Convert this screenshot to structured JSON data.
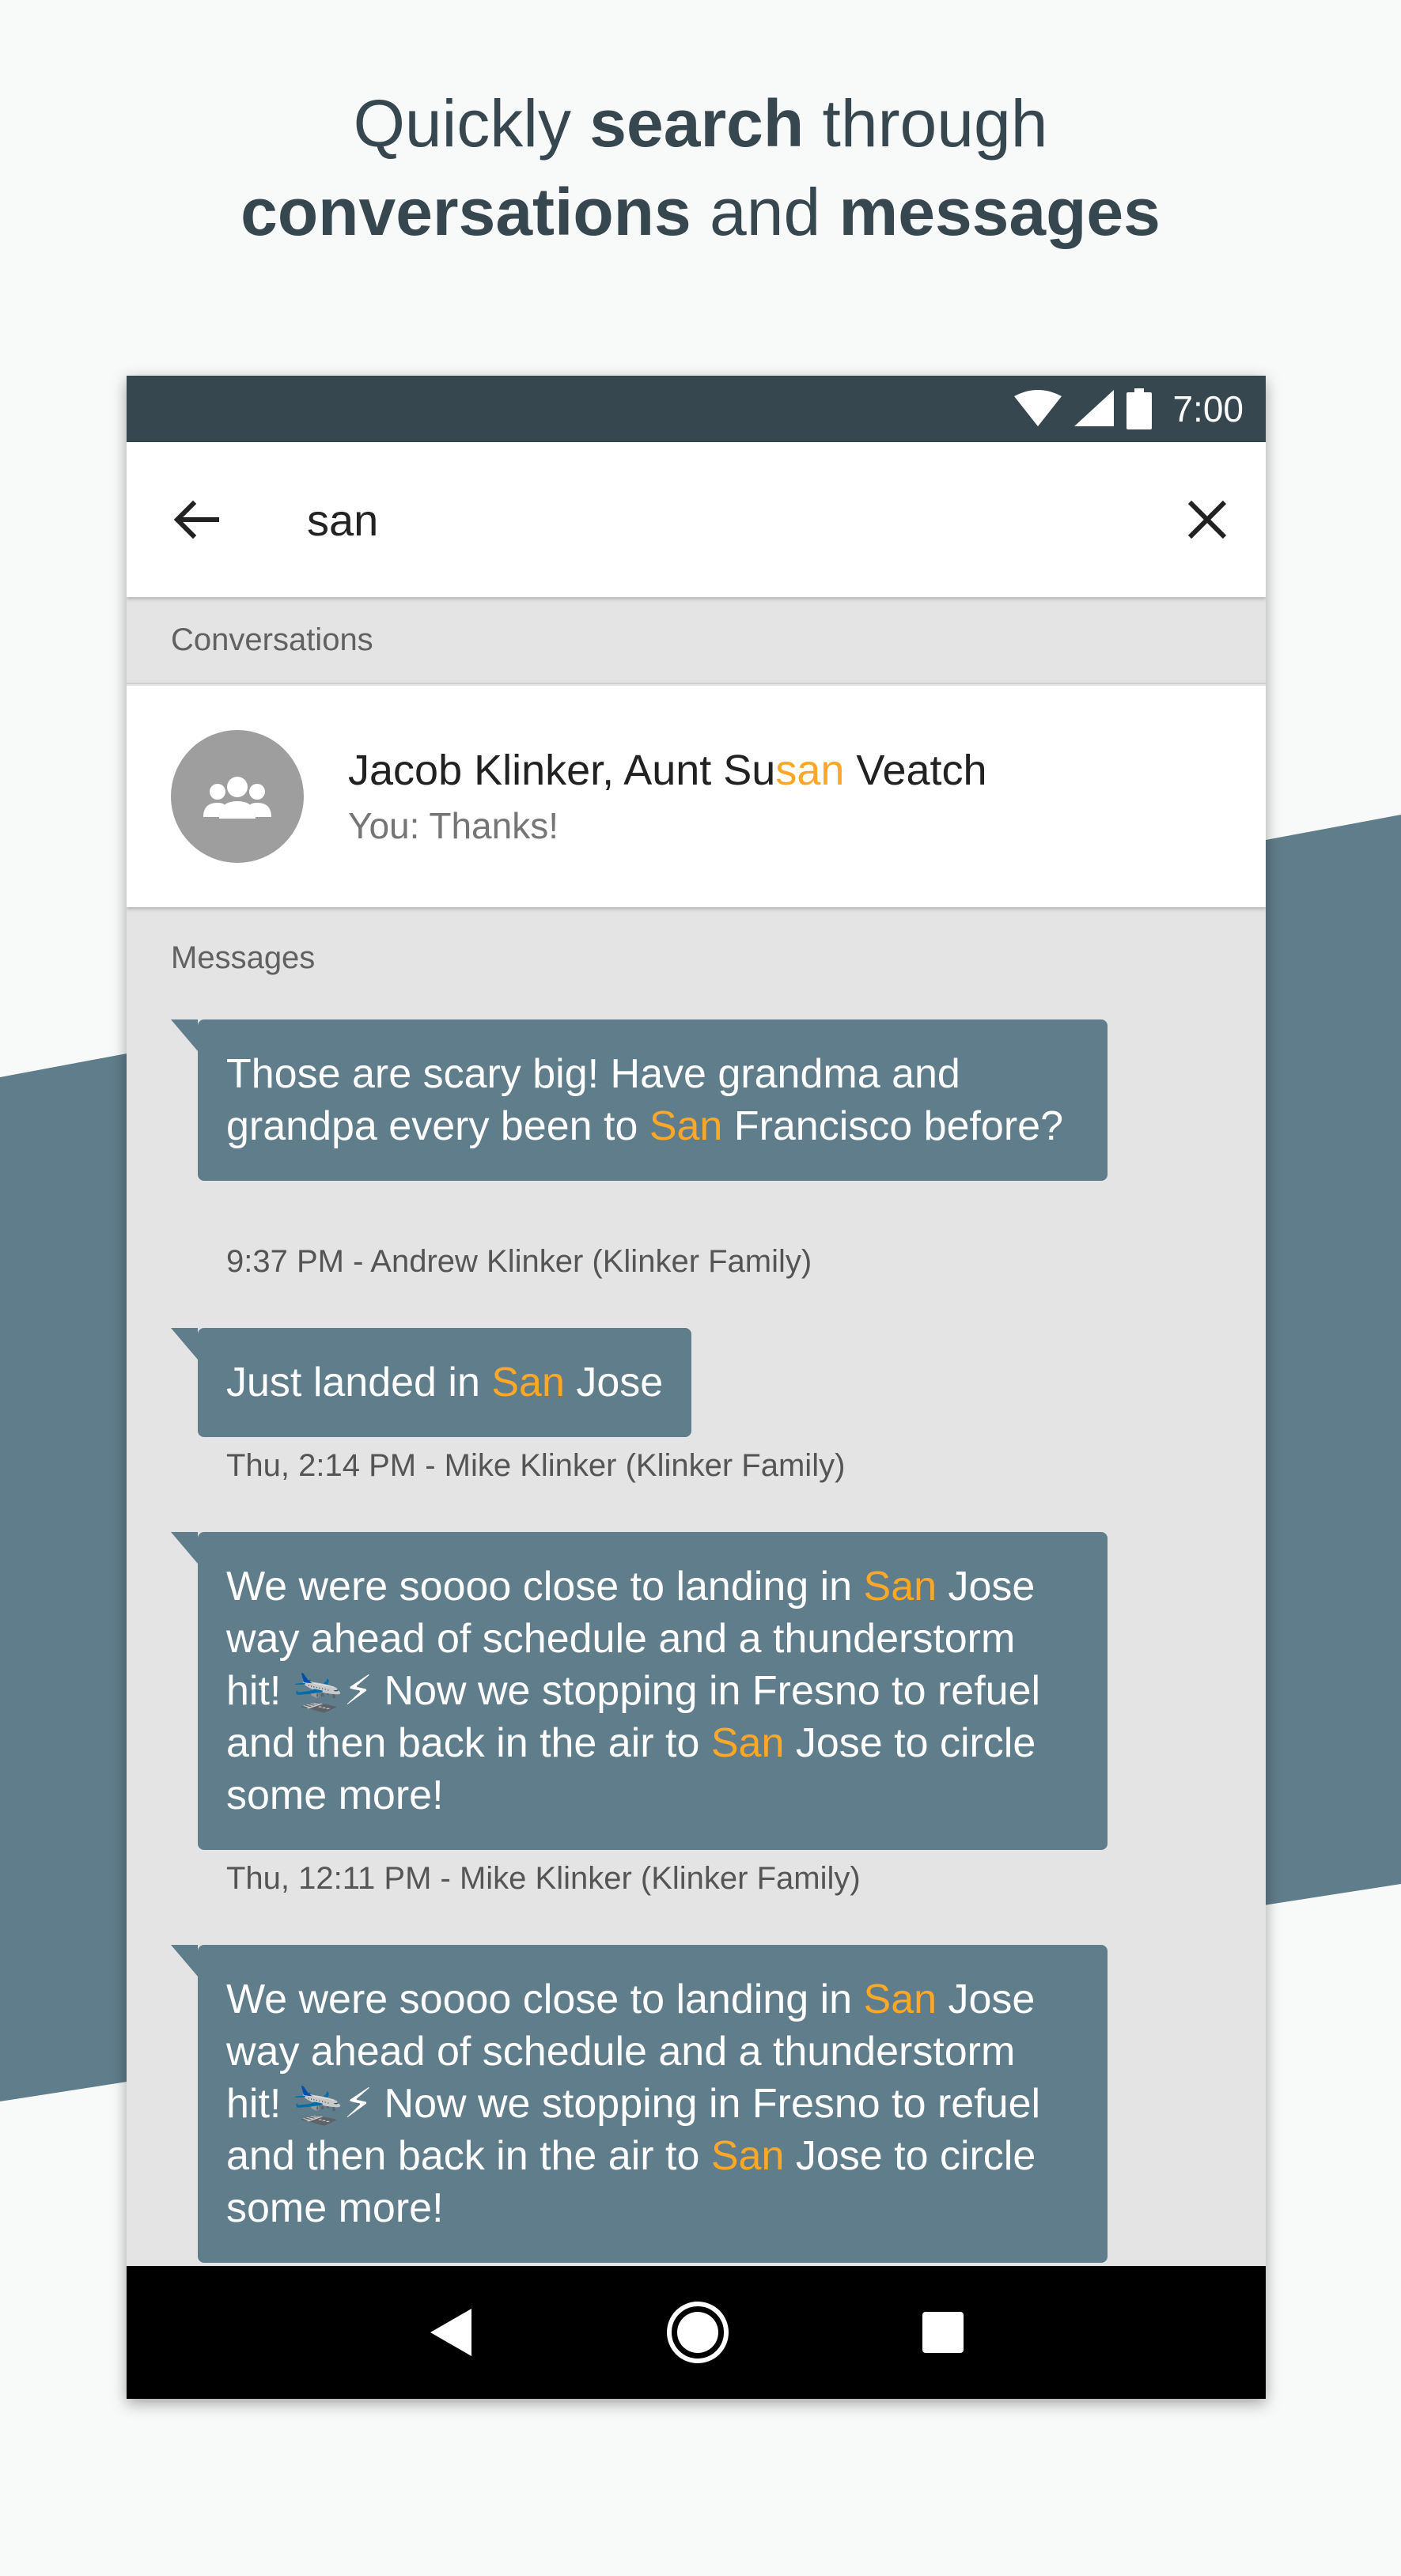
{
  "headline": {
    "line1_a": "Quickly ",
    "line1_b": "search",
    "line1_c": " through",
    "line2_a": "conversations",
    "line2_b": " and ",
    "line2_c": "messages"
  },
  "status_bar": {
    "time": "7:00"
  },
  "search": {
    "query": "san"
  },
  "sections": {
    "conversations_label": "Conversations",
    "messages_label": "Messages"
  },
  "conversation": {
    "title_before": "Jacob Klinker, Aunt Su",
    "title_match": "san",
    "title_after": " Veatch",
    "snippet": "You: Thanks!"
  },
  "messages": [
    {
      "segments": [
        {
          "t": "Those are scary big! Have grandma and grandpa every been to ",
          "hl": false
        },
        {
          "t": "San",
          "hl": true
        },
        {
          "t": " Francisco before?",
          "hl": false
        }
      ],
      "meta": "9:37 PM - Andrew Klinker (Klinker Family)"
    },
    {
      "segments": [
        {
          "t": "Just landed in ",
          "hl": false
        },
        {
          "t": "San",
          "hl": true
        },
        {
          "t": " Jose",
          "hl": false
        }
      ],
      "meta": "Thu, 2:14 PM - Mike Klinker (Klinker Family)"
    },
    {
      "segments": [
        {
          "t": "We were soooo close to landing in ",
          "hl": false
        },
        {
          "t": "San",
          "hl": true
        },
        {
          "t": " Jose way ahead of schedule and a thunderstorm hit! 🛬⚡ Now we stopping in Fresno to refuel and then back in the air to ",
          "hl": false
        },
        {
          "t": "San",
          "hl": true
        },
        {
          "t": " Jose to circle some more!",
          "hl": false
        }
      ],
      "meta": "Thu, 12:11 PM - Mike Klinker (Klinker Family)"
    },
    {
      "segments": [
        {
          "t": "We were soooo close to landing in ",
          "hl": false
        },
        {
          "t": "San",
          "hl": true
        },
        {
          "t": " Jose way ahead of schedule and a thunderstorm hit! 🛬⚡ Now we stopping in Fresno to refuel and then back in the air to ",
          "hl": false
        },
        {
          "t": "San",
          "hl": true
        },
        {
          "t": " Jose to circle some more!",
          "hl": false
        }
      ],
      "meta": ""
    }
  ],
  "colors": {
    "accent": "#607d8b",
    "dark": "#37474f",
    "highlight": "#ffa726"
  }
}
